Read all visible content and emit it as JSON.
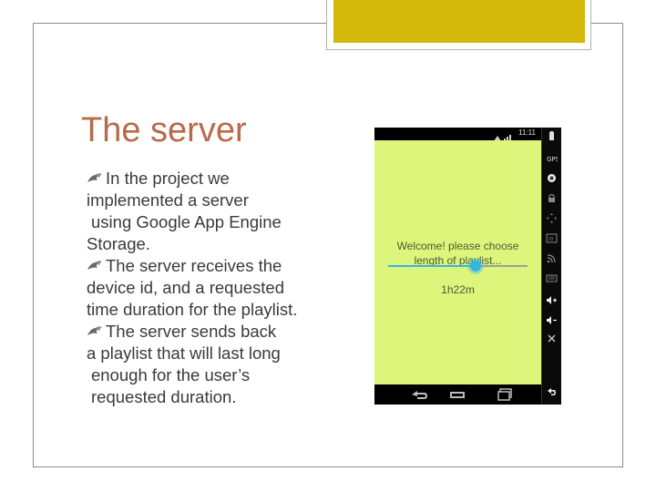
{
  "slide": {
    "title": "The server",
    "bullets": [
      {
        "lines": [
          "In the project we",
          "implemented a server",
          "using Google App Engine",
          "Storage."
        ]
      },
      {
        "lines": [
          "The server receives the",
          "device id, and a requested",
          "time duration for the playlist."
        ]
      },
      {
        "lines": [
          "The server sends back",
          "a playlist that will last long",
          "enough for the user’s",
          "requested duration."
        ]
      }
    ],
    "bullet_icon": "fleuron-bullet-icon",
    "colors": {
      "title": "#b86a4a",
      "accent_tab": "#d4b80a",
      "body_text": "#3a3a3a"
    }
  },
  "phone": {
    "status_time": "11:11",
    "prompt_line1": "Welcome! please choose",
    "prompt_line2": "length of playlist...",
    "duration": "1h22m",
    "slider_fraction": 0.63,
    "screen_color": "#dcf57a",
    "accent_color": "#33b5e5",
    "nav_buttons": [
      "back-icon",
      "home-icon",
      "recent-apps-icon"
    ],
    "side_tools": [
      "battery-icon",
      "gps-icon",
      "camera-icon",
      "lock-icon",
      "dpad-icon",
      "id-icon",
      "rss-icon",
      "keyboard-icon",
      "volume-up-icon",
      "volume-down-icon",
      "rotate-icon",
      "back-arrow-icon"
    ]
  }
}
